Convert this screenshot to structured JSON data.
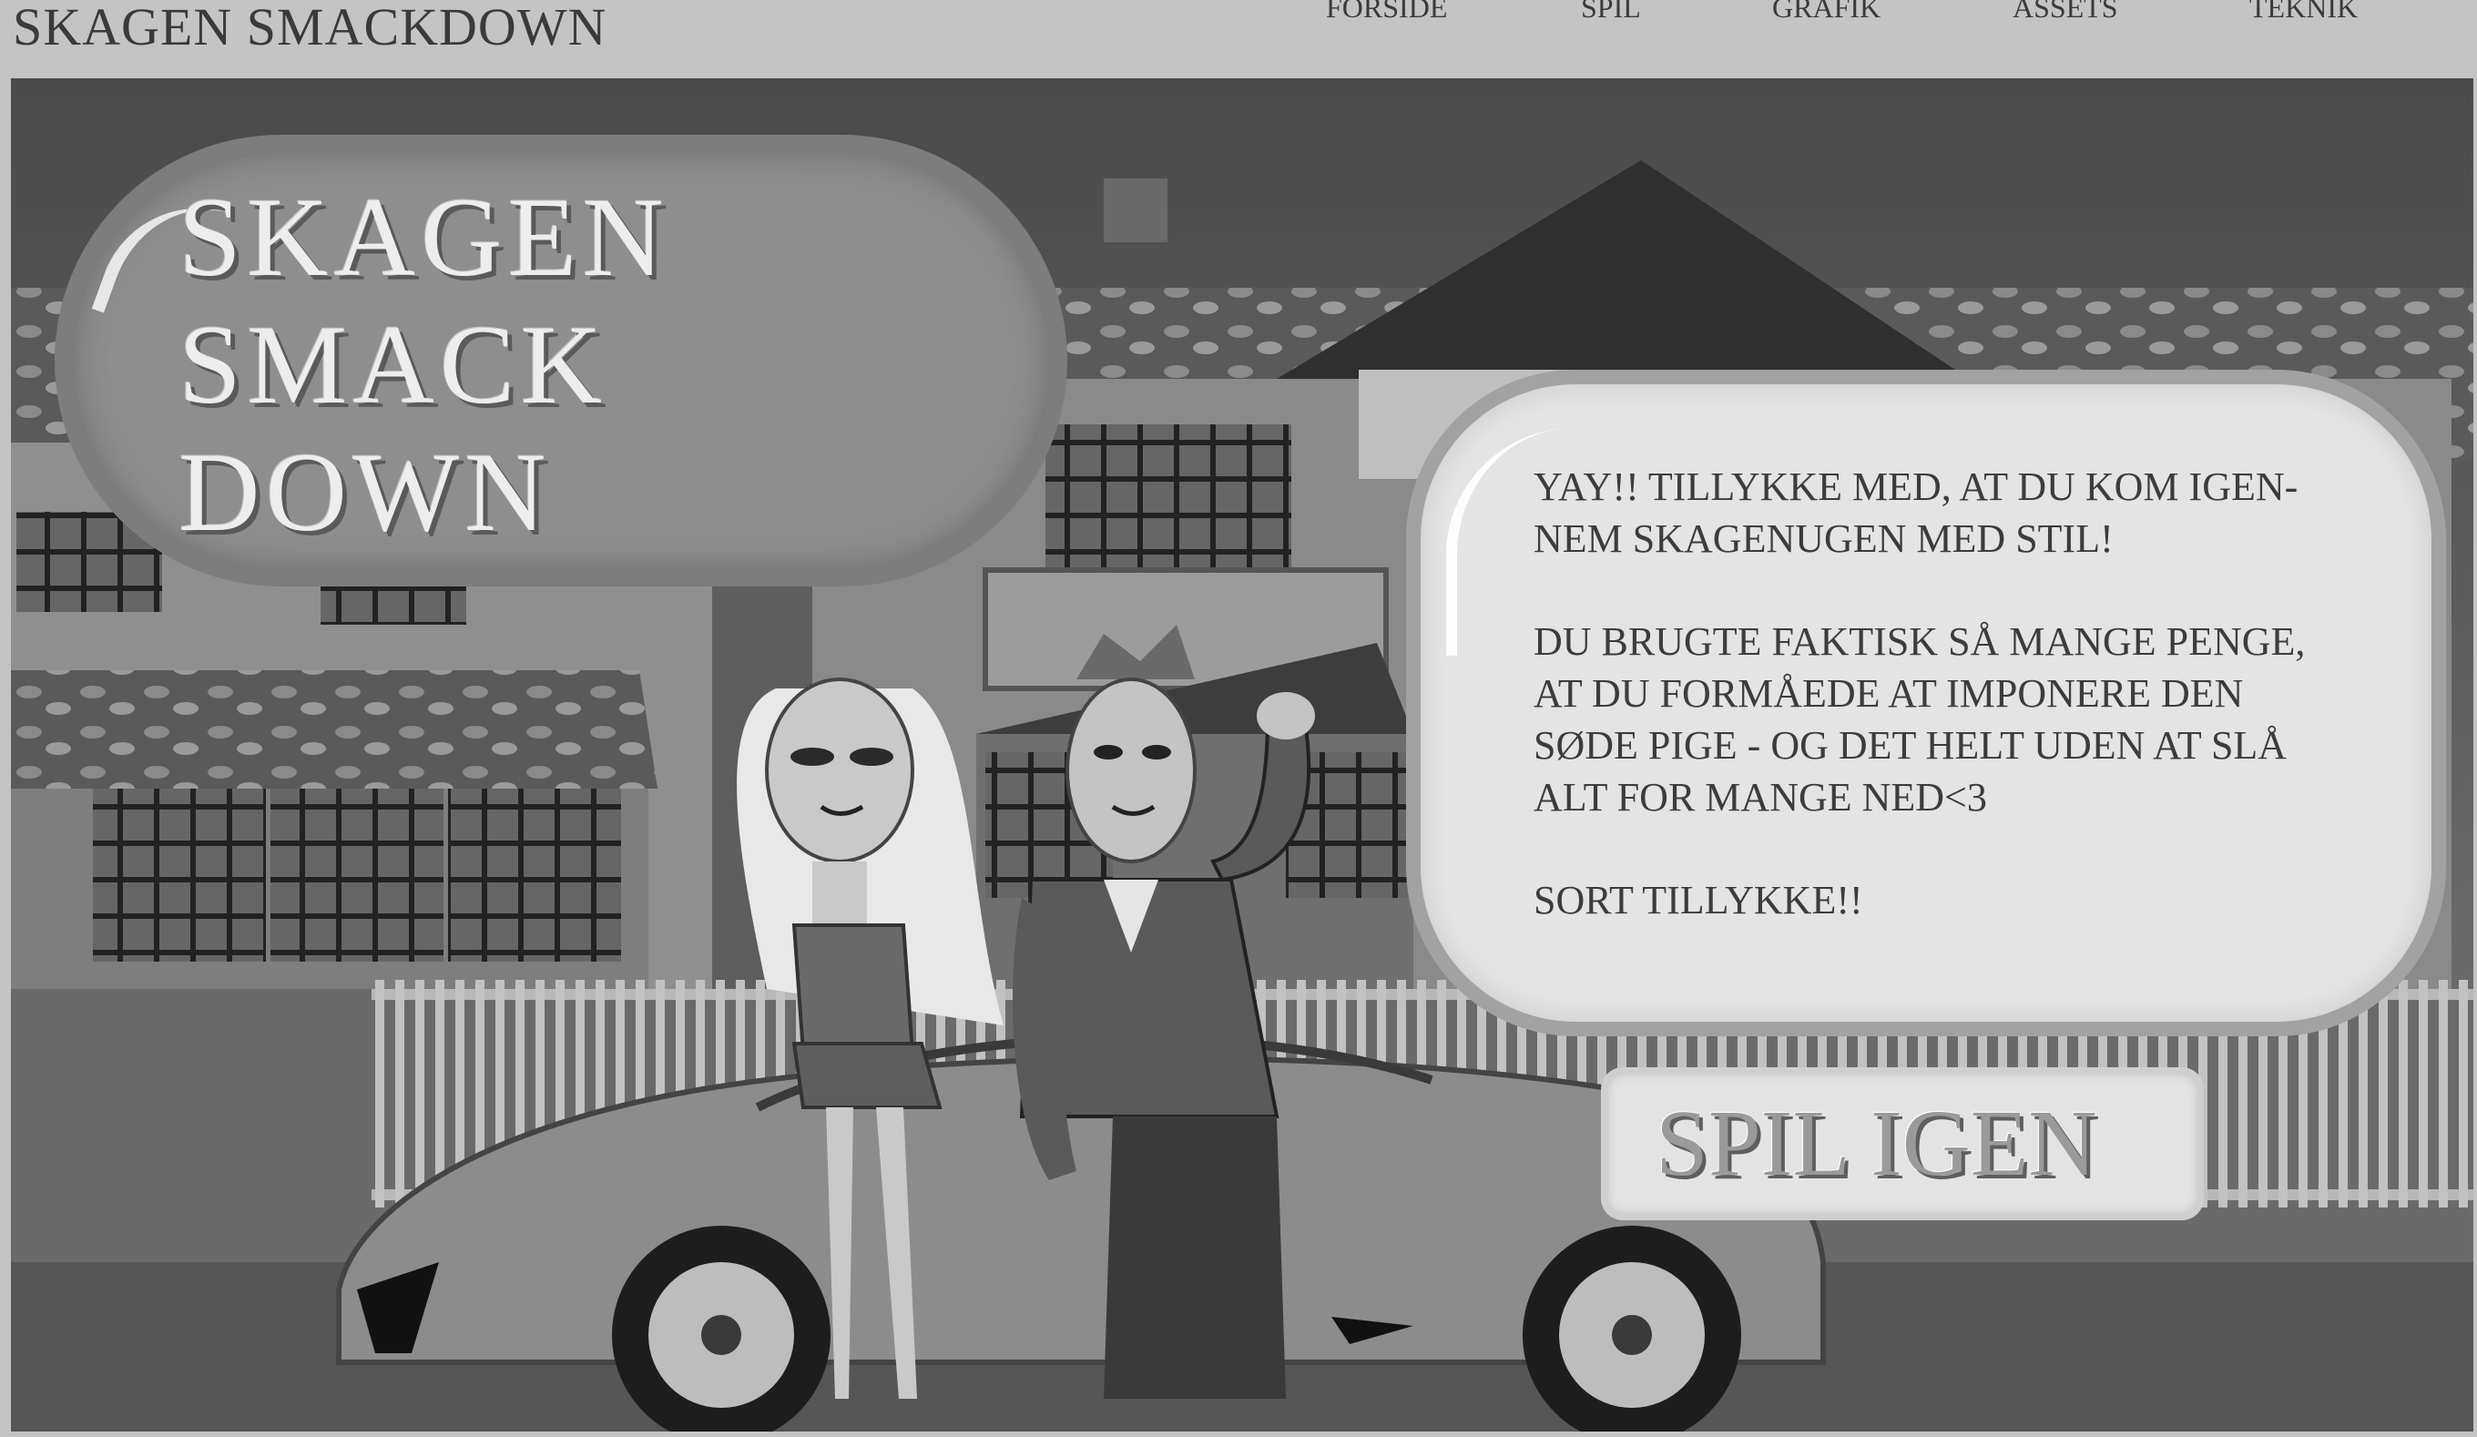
{
  "header": {
    "site_title": "SKAGEN SMACKDOWN",
    "nav": [
      "FORSIDE",
      "SPIL",
      "GRAFIK",
      "ASSETS",
      "TEKNIK"
    ]
  },
  "game": {
    "title_lines": [
      "SKAGEN",
      "SMACK",
      "DOWN"
    ],
    "message_paragraphs": [
      "YAY!! TILLYKKE MED, AT DU KOM IGEN-\nNEM SKAGENUGEN MED STIL!",
      "DU BRUGTE FAKTISK SÅ MANGE PENGE,\nAT DU FORMÅEDE AT IMPONERE DEN\nSØDE PIGE - OG DET HELT UDEN AT SLÅ\nALT FOR MANGE NED<3",
      "SORT TILLYKKE!!"
    ],
    "play_again_label": "SPIL IGEN",
    "scene_icons": [
      "house",
      "sports-car",
      "girl-character",
      "boy-character",
      "fence"
    ]
  },
  "colors": {
    "page_bg": "#c4c4c4",
    "bubble_fill": "#e4e4e4",
    "title_fill": "#8e8e8e"
  }
}
